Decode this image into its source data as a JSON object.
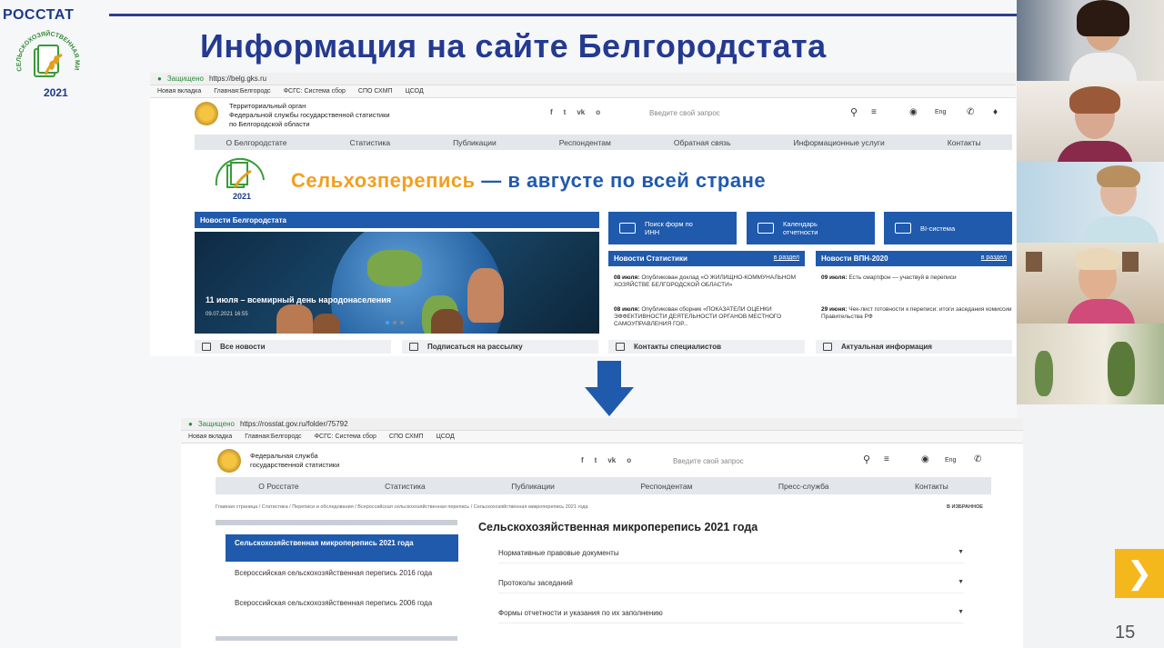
{
  "slide": {
    "brand": "РОССТАТ",
    "emblem_arc_text": "СЕЛЬСКОХОЗЯЙСТВЕННАЯ МИКРОПЕРЕПИСЬ",
    "emblem_year": "2021",
    "title": "Информация на сайте Белгородстата",
    "page_number": "15"
  },
  "shot1": {
    "secure_label": "Защищено",
    "url": "https://belg.gks.ru",
    "bookmarks": [
      "Новая вкладка",
      "Главная:Белгородс",
      "ФСГС: Система сбор",
      "СПО СХМП",
      "ЦСОД"
    ],
    "org_line1": "Территориальный орган",
    "org_line2": "Федеральной службы государственной статистики",
    "org_line3": "по Белгородской области",
    "search_placeholder": "Введите свой запрос",
    "lang": "Eng",
    "nav": [
      "О Белгородстате",
      "Статистика",
      "Публикации",
      "Респондентам",
      "Обратная связь",
      "Информационные услуги",
      "Контакты"
    ],
    "banner_part1": "Сельхозперепись",
    "banner_part2": " — в августе по всей стране",
    "news_head": "Новости Белгородстата",
    "news_caption": "11 июля – всемирный день народонаселения",
    "news_date": "09.07.2021 16:55",
    "tiles": [
      "Поиск форм по ИНН",
      "Календарь отчетности",
      "BI-система"
    ],
    "stat_head": "Новости Статистики",
    "vpn_head": "Новости ВПН-2020",
    "section_link": "в раздел",
    "stat_news": [
      {
        "date": "08 июля:",
        "text": "Опубликован доклад «О ЖИЛИЩНО-КОММУНАЛЬНОМ ХОЗЯЙСТВЕ БЕЛГОРОДСКОЙ ОБЛАСТИ»"
      },
      {
        "date": "08 июля:",
        "text": "Опубликован сборник «ПОКАЗАТЕЛИ ОЦЕНКИ ЭФФЕКТИВНОСТИ ДЕЯТЕЛЬНОСТИ ОРГАНОВ МЕСТНОГО САМОУПРАВЛЕНИЯ ГОР..."
      }
    ],
    "vpn_news": [
      {
        "date": "09 июля:",
        "text": "Есть смартфон — участвуй в переписи"
      },
      {
        "date": "29 июня:",
        "text": "Чек-лист готовности к переписи: итоги заседания комиссии Правительства РФ"
      }
    ],
    "footer_links": [
      "Все новости",
      "Подписаться на рассылку",
      "Контакты специалистов",
      "Актуальная информация"
    ]
  },
  "shot2": {
    "secure_label": "Защищено",
    "url": "https://rosstat.gov.ru/folder/75792",
    "bookmarks": [
      "Новая вкладка",
      "Главная:Белгородс",
      "ФСГС: Система сбор",
      "СПО СХМП",
      "ЦСОД"
    ],
    "org_line1": "Федеральная служба",
    "org_line2": "государственной статистики",
    "search_placeholder": "Введите свой запрос",
    "lang": "Eng",
    "nav": [
      "О Росстате",
      "Статистика",
      "Публикации",
      "Респондентам",
      "Пресс-служба",
      "Контакты"
    ],
    "breadcrumbs": "Главная страница / Статистика / Переписи и обследования / Всероссийская сельскохозяйственная перепись / Сельскохозяйственная микроперепись 2021 года",
    "favorites": "В ИЗБРАННОЕ",
    "sidebar": [
      "Сельскохозяйственная микроперепись 2021 года",
      "Всероссийская сельскохозяйственная перепись 2016 года",
      "Всероссийская сельскохозяйственная перепись 2006 года"
    ],
    "main_title": "Сельскохозяйственная микроперепись 2021 года",
    "accordion": [
      "Нормативные правовые документы",
      "Протоколы заседаний",
      "Формы отчетности и указания по их заполнению"
    ]
  },
  "colors": {
    "brand_blue": "#1f5aad",
    "title_blue": "#243a91",
    "banner_orange": "#f0a020",
    "banner_blue": "#1f5aad",
    "next_yellow": "#f5b81c"
  }
}
